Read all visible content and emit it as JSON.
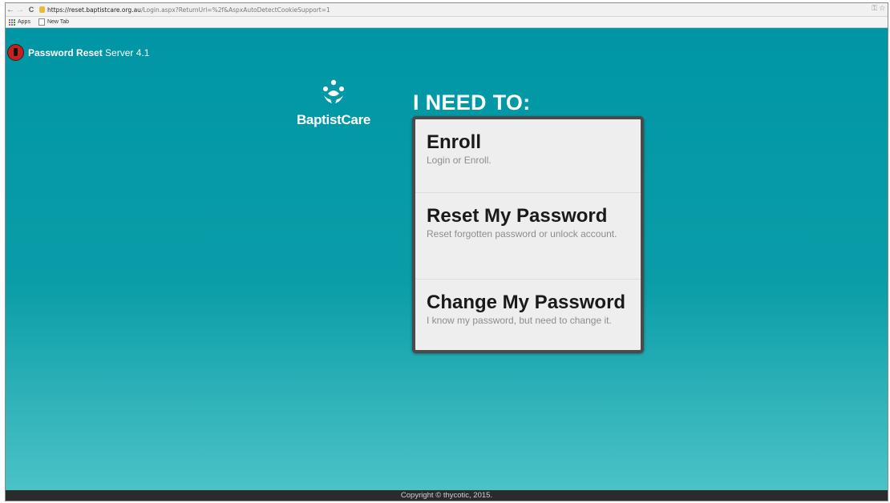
{
  "browser": {
    "back": "←",
    "forward": "→",
    "reload": "C",
    "url_host": "https://reset.baptistcare.org.au",
    "url_path": "/Login.aspx?ReturnUrl=%2f&AspxAutoDetectCookieSupport=1",
    "bookmarks": [
      "Apps",
      "New Tab"
    ]
  },
  "header": {
    "app_name_bold": "Password Reset",
    "app_name_rest": " Server 4.1"
  },
  "brand": {
    "name": "BaptistCare"
  },
  "main": {
    "heading": "I NEED TO:",
    "options": [
      {
        "title": "Enroll",
        "description": "Login or Enroll."
      },
      {
        "title": "Reset My Password",
        "description": "Reset forgotten password or unlock account."
      },
      {
        "title": "Change My Password",
        "description": "I know my password, but need to change it."
      }
    ]
  },
  "footer": {
    "copyright": "Copyright © thycotic, 2015."
  },
  "colors": {
    "page_bg": "#0096a5",
    "footer_bg": "#2b2b2b",
    "card_bg": "#eeeeee",
    "card_border": "#4a4a4a"
  }
}
